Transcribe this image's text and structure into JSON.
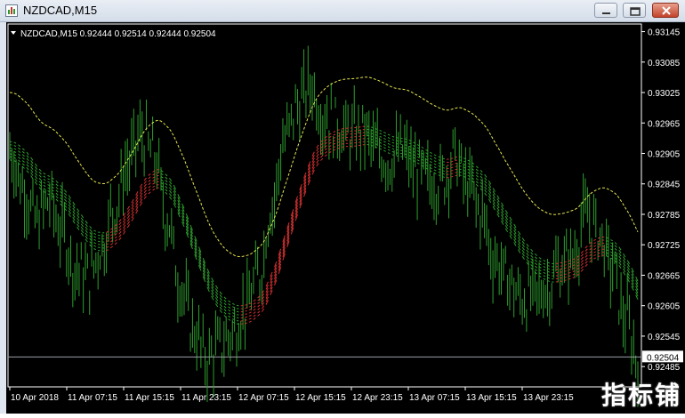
{
  "window": {
    "title": "NZDCAD,M15"
  },
  "chart": {
    "header": "NZDCAD,M15  0.92444 0.92514 0.92444 0.92504",
    "current_price": "0.92504",
    "watermark": "指标铺"
  },
  "colors": {
    "background": "#000000",
    "candles": "#2e9e2e",
    "band_down": "#d03030",
    "band_up": "#2ea02e",
    "envelope": "#e6e650",
    "axis_text": "#ffffff",
    "price_line": "#9aa0a8"
  },
  "chart_data": {
    "type": "line",
    "series": [
      {
        "values": [
          0.9291,
          0.9284,
          0.9277,
          0.9281,
          0.9275,
          0.9268,
          0.9266,
          0.9272,
          0.928,
          0.9288,
          0.9294,
          0.929,
          0.9278,
          0.9265,
          0.9256,
          0.925,
          0.9252,
          0.9255,
          0.926,
          0.9266,
          0.928,
          0.9293,
          0.93,
          0.9304,
          0.9298,
          0.9296,
          0.9294,
          0.9295,
          0.9291,
          0.9289,
          0.9291,
          0.9287,
          0.9285,
          0.9285,
          0.929,
          0.9284,
          0.9279,
          0.927,
          0.9266,
          0.9262,
          0.9262,
          0.9264,
          0.9268,
          0.927,
          0.9278,
          0.9275,
          0.9268,
          0.9258,
          0.925
        ]
      }
    ],
    "y_axis_ticks": [
      "0.93145",
      "0.93085",
      "0.93025",
      "0.92965",
      "0.92905",
      "0.92845",
      "0.92785",
      "0.92725",
      "0.92665",
      "0.92605",
      "0.92545",
      "0.92485"
    ],
    "x_axis_ticks": [
      "10 Apr 2018",
      "11 Apr 07:15",
      "11 Apr 15:15",
      "11 Apr 23:15",
      "12 Apr 07:15",
      "12 Apr 15:15",
      "12 Apr 23:15",
      "13 Apr 07:15",
      "13 Apr 15:15",
      "13 Apr 23:15"
    ],
    "ylim": [
      0.92445,
      0.9316
    ],
    "price_line_value": 0.92504,
    "grid": false
  }
}
